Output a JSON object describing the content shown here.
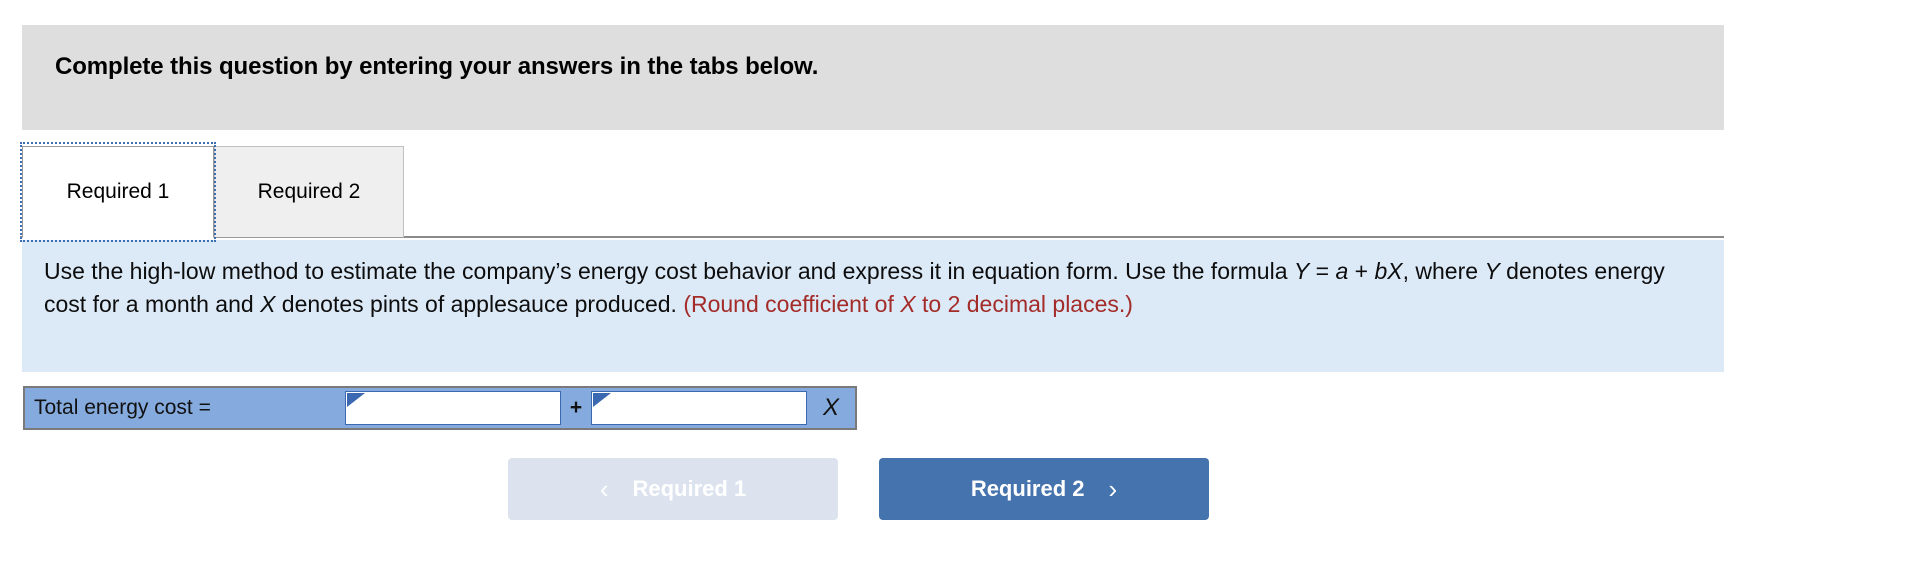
{
  "banner": {
    "text": "Complete this question by entering your answers in the tabs below."
  },
  "tabs": [
    {
      "label": "Required 1",
      "state": "active"
    },
    {
      "label": "Required 2",
      "state": "inactive"
    }
  ],
  "instructions": {
    "part1": "Use the high-low method to estimate the company’s energy cost behavior and express it in equation form. Use the formula ",
    "var_y1": "Y",
    "part2": " = ",
    "var_a": "a",
    "part3": " + ",
    "var_bx": "bX",
    "part4": ", where ",
    "var_y2": "Y",
    "part5": " denotes energy cost for a month and ",
    "var_x": "X",
    "part6": " denotes pints of applesauce produced. ",
    "note_pre": "(Round coefficient of ",
    "note_var": "X",
    "note_post": " to 2 decimal places.)"
  },
  "answer_row": {
    "label": "Total energy cost =",
    "operator": "+",
    "variable": "X",
    "field_a": {
      "value": "",
      "placeholder": ""
    },
    "field_b": {
      "value": "",
      "placeholder": ""
    }
  },
  "navigation": {
    "prev": {
      "label": "Required 1",
      "icon": "chevron-left-icon",
      "glyph": "‹",
      "enabled": false
    },
    "next": {
      "label": "Required 2",
      "icon": "chevron-right-icon",
      "glyph": "›",
      "enabled": true
    }
  },
  "colors": {
    "banner_bg": "#dedede",
    "instructions_bg": "#dce9f7",
    "answer_bg": "#85aade",
    "note_red": "#a32b28",
    "primary_blue": "#4473ae",
    "disabled_blue": "#dce3ee",
    "focus_outline": "#3b6fb5"
  }
}
